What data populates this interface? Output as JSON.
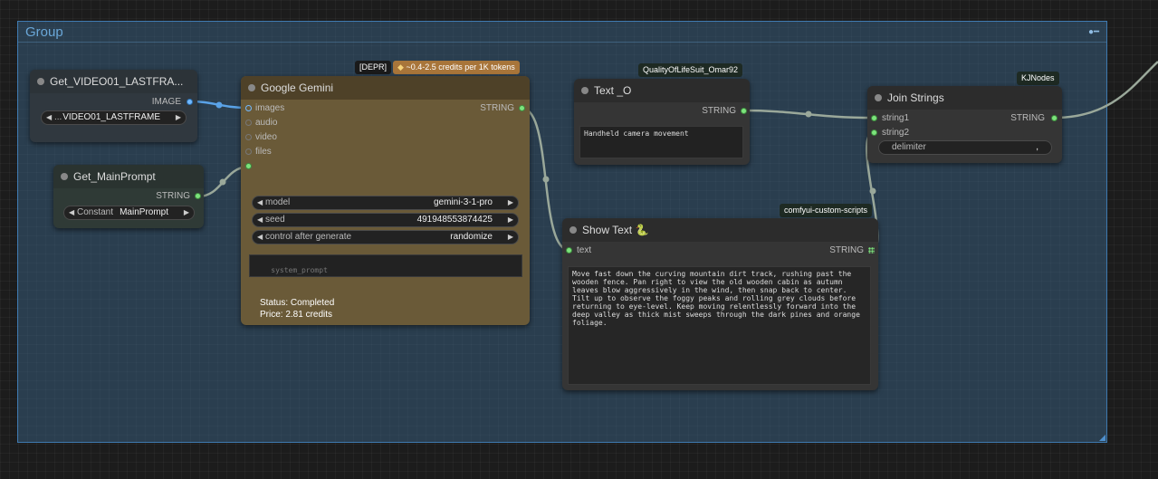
{
  "group": {
    "title": "Group"
  },
  "nodes": {
    "get_video": {
      "title": "Get_VIDEO01_LASTFRA...",
      "output_label": "IMAGE",
      "widget_prefix": "...",
      "widget_value": "VIDEO01_LASTFRAME"
    },
    "get_prompt": {
      "title": "Get_MainPrompt",
      "output_label": "STRING",
      "widget_label": "Constant",
      "widget_value": "MainPrompt"
    },
    "gemini": {
      "title": "Google Gemini",
      "badge_depr": "[DEPR]",
      "badge_credits": "~0.4-2.5 credits per 1K tokens",
      "inputs": [
        "images",
        "audio",
        "video",
        "files"
      ],
      "output_label": "STRING",
      "widgets": [
        {
          "label": "model",
          "value": "gemini-3-1-pro"
        },
        {
          "label": "seed",
          "value": "491948553874425"
        },
        {
          "label": "control after generate",
          "value": "randomize"
        }
      ],
      "system_prompt_placeholder": "system_prompt",
      "status": "Status: Completed",
      "price": "Price: 2.81 credits"
    },
    "text_o": {
      "title": "Text _O",
      "badge": "QualityOfLifeSuit_Omar92",
      "output_label": "STRING",
      "text": "Handheld camera movement"
    },
    "join": {
      "title": "Join Strings",
      "badge": "KJNodes",
      "inputs": [
        "string1",
        "string2"
      ],
      "output_label": "STRING",
      "widget_label": "delimiter",
      "widget_value": ","
    },
    "show_text": {
      "title": "Show Text",
      "title_icon": "snake-emoji",
      "title_icon_glyph": "🐍",
      "badge": "comfyui-custom-scripts",
      "input_label": "text",
      "output_label": "STRING",
      "text": "Move fast down the curving mountain dirt track, rushing past the wooden fence. Pan right to view the old wooden cabin as autumn leaves blow aggressively in the wind, then snap back to center. Tilt up to observe the foggy peaks and rolling grey clouds before returning to eye-level. Keep moving relentlessly forward into the deep valley as thick mist sweeps through the dark pines and orange foliage."
    }
  },
  "colors": {
    "group_fill": "#3e6e96",
    "gemini_body": "#6a5a38",
    "gemini_title": "#4e4128",
    "string_port": "#7ce37c",
    "image_port": "#72b9ff",
    "wire": "#9aa89a"
  }
}
